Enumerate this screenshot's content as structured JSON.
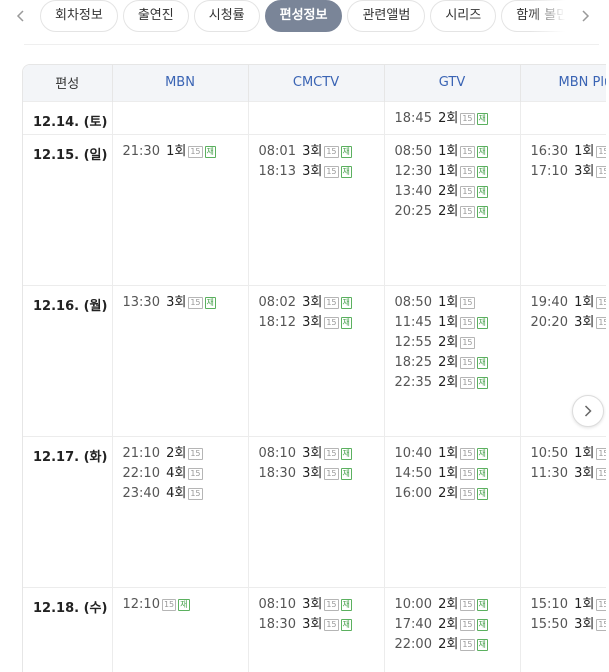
{
  "tabs": [
    {
      "label": "회차정보",
      "active": false
    },
    {
      "label": "출연진",
      "active": false
    },
    {
      "label": "시청률",
      "active": false
    },
    {
      "label": "편성정보",
      "active": true
    },
    {
      "label": "관련앨범",
      "active": false
    },
    {
      "label": "시리즈",
      "active": false
    },
    {
      "label": "함께 볼만",
      "active": false
    }
  ],
  "icons": {
    "prev": "chevron-left-icon",
    "next": "chevron-right-icon"
  },
  "colors": {
    "active_tab": "#7a8598",
    "channel_header": "#3a64b4",
    "rerun_badge": "#44a04a"
  },
  "schedule": {
    "corner_label": "편성",
    "channels": [
      "MBN",
      "CMCTV",
      "GTV",
      "MBN Plus"
    ],
    "rows": [
      {
        "date": "12.14. (토)",
        "cells": [
          [],
          [],
          [
            {
              "time": "18:45",
              "ep": "2회",
              "age": "15",
              "re": "재"
            }
          ],
          []
        ]
      },
      {
        "date": "12.15. (일)",
        "cells": [
          [
            {
              "time": "21:30",
              "ep": "1회",
              "age": "15",
              "re": "재"
            }
          ],
          [
            {
              "time": "08:01",
              "ep": "3회",
              "age": "15",
              "re": "재"
            },
            {
              "time": "18:13",
              "ep": "3회",
              "age": "15",
              "re": "재"
            }
          ],
          [
            {
              "time": "08:50",
              "ep": "1회",
              "age": "15",
              "re": "재"
            },
            {
              "time": "12:30",
              "ep": "1회",
              "age": "15",
              "re": "재"
            },
            {
              "time": "13:40",
              "ep": "2회",
              "age": "15",
              "re": "재"
            },
            {
              "time": "20:25",
              "ep": "2회",
              "age": "15",
              "re": "재"
            }
          ],
          [
            {
              "time": "16:30",
              "ep": "1회",
              "age": "15",
              "re": "재"
            },
            {
              "time": "17:10",
              "ep": "3회",
              "age": "15",
              "re": "재"
            }
          ]
        ]
      },
      {
        "date": "12.16. (월)",
        "cells": [
          [
            {
              "time": "13:30",
              "ep": "3회",
              "age": "15",
              "re": "재"
            }
          ],
          [
            {
              "time": "08:02",
              "ep": "3회",
              "age": "15",
              "re": "재"
            },
            {
              "time": "18:12",
              "ep": "3회",
              "age": "15",
              "re": "재"
            }
          ],
          [
            {
              "time": "08:50",
              "ep": "1회",
              "age": "15",
              "re": ""
            },
            {
              "time": "11:45",
              "ep": "1회",
              "age": "15",
              "re": "재"
            },
            {
              "time": "12:55",
              "ep": "2회",
              "age": "15",
              "re": ""
            },
            {
              "time": "18:25",
              "ep": "2회",
              "age": "15",
              "re": "재"
            },
            {
              "time": "22:35",
              "ep": "2회",
              "age": "15",
              "re": "재"
            }
          ],
          [
            {
              "time": "19:40",
              "ep": "1회",
              "age": "15",
              "re": "재"
            },
            {
              "time": "20:20",
              "ep": "3회",
              "age": "15",
              "re": "재"
            }
          ]
        ]
      },
      {
        "date": "12.17. (화)",
        "cells": [
          [
            {
              "time": "21:10",
              "ep": "2회",
              "age": "15",
              "re": ""
            },
            {
              "time": "22:10",
              "ep": "4회",
              "age": "15",
              "re": ""
            },
            {
              "time": "23:40",
              "ep": "4회",
              "age": "15",
              "re": ""
            }
          ],
          [
            {
              "time": "08:10",
              "ep": "3회",
              "age": "15",
              "re": "재"
            },
            {
              "time": "18:30",
              "ep": "3회",
              "age": "15",
              "re": "재"
            }
          ],
          [
            {
              "time": "10:40",
              "ep": "1회",
              "age": "15",
              "re": "재"
            },
            {
              "time": "14:50",
              "ep": "1회",
              "age": "15",
              "re": "재"
            },
            {
              "time": "16:00",
              "ep": "2회",
              "age": "15",
              "re": "재"
            }
          ],
          [
            {
              "time": "10:50",
              "ep": "1회",
              "age": "15",
              "re": "재"
            },
            {
              "time": "11:30",
              "ep": "3회",
              "age": "15",
              "re": "재"
            }
          ]
        ]
      },
      {
        "date": "12.18. (수)",
        "cells": [
          [
            {
              "time": "12:10",
              "ep": "",
              "age": "15",
              "re": "재"
            }
          ],
          [
            {
              "time": "08:10",
              "ep": "3회",
              "age": "15",
              "re": "재"
            },
            {
              "time": "18:30",
              "ep": "3회",
              "age": "15",
              "re": "재"
            }
          ],
          [
            {
              "time": "10:00",
              "ep": "2회",
              "age": "15",
              "re": "재"
            },
            {
              "time": "17:40",
              "ep": "2회",
              "age": "15",
              "re": "재"
            },
            {
              "time": "22:00",
              "ep": "2회",
              "age": "15",
              "re": "재"
            }
          ],
          [
            {
              "time": "15:10",
              "ep": "1회",
              "age": "15",
              "re": "재"
            },
            {
              "time": "15:50",
              "ep": "3회",
              "age": "15",
              "re": "재"
            }
          ]
        ]
      }
    ]
  }
}
